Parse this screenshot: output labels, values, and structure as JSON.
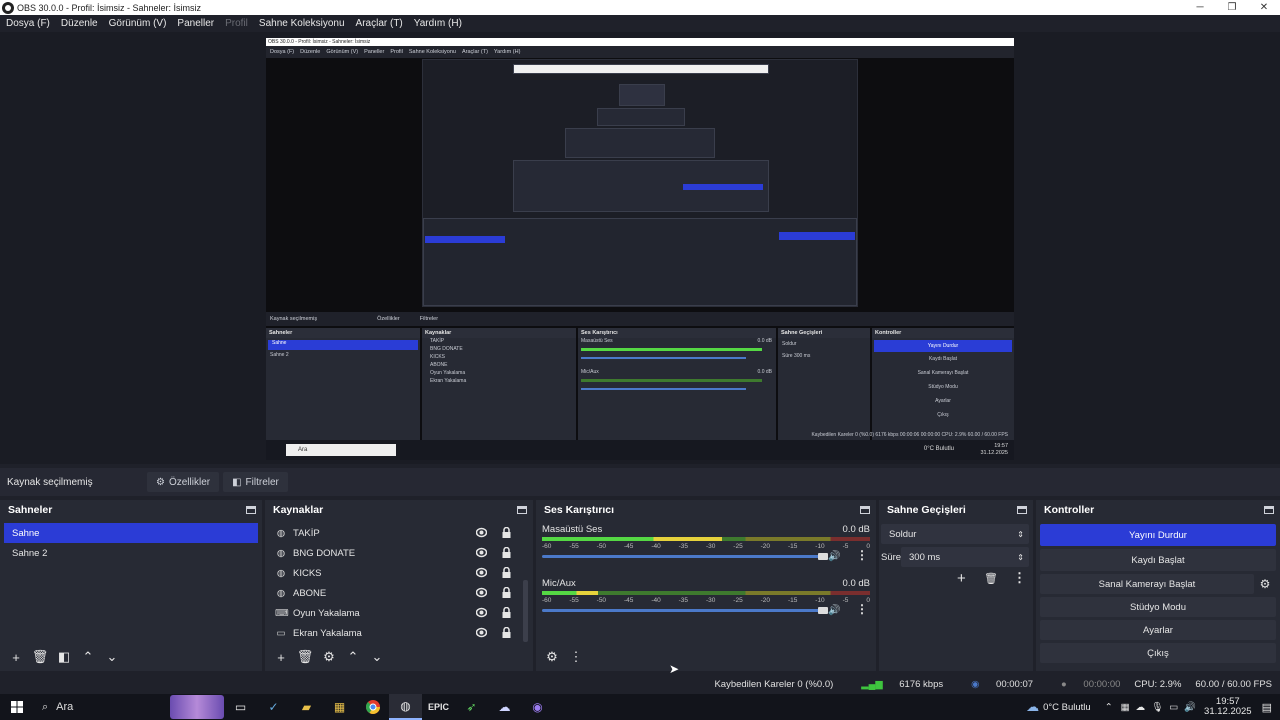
{
  "window": {
    "title": "OBS 30.0.0 - Profil: İsimsiz - Sahneler: İsimsiz",
    "minimize": "─",
    "maximize": "❐",
    "close": "✕"
  },
  "menu": {
    "items": [
      "Dosya (F)",
      "Düzenle",
      "Görünüm (V)",
      "Paneller",
      "Profil",
      "Sahne Koleksiyonu",
      "Araçlar (T)",
      "Yardım (H)"
    ]
  },
  "preview": {
    "menu_title": "OBS 30.0.0 - Profil: İsimsiz - Sahneler: İsimsiz",
    "menu_items": [
      "Dosya (F)",
      "Düzenle",
      "Görünüm (V)",
      "Paneller",
      "Profil",
      "Sahne Koleksiyonu",
      "Araçlar (T)",
      "Yardım (H)"
    ],
    "select_label": "Kaynak seçilmemiş",
    "props": "Özellikler",
    "filters": "Filtreler",
    "scenes_title": "Sahneler",
    "scenes": [
      "Sahne",
      "Sahne 2"
    ],
    "sources_title": "Kaynaklar",
    "sources": [
      "TAKİP",
      "BNG DONATE",
      "KICKS",
      "ABONE",
      "Oyun Yakalama",
      "Ekran Yakalama"
    ],
    "mixer_title": "Ses Karıştırıcı",
    "ch1": "Masaüstü Ses",
    "ch2": "Mic/Aux",
    "db": "0.0 dB",
    "trans_title": "Sahne Geçişleri",
    "trans": "Soldur",
    "dur_label": "Süre",
    "dur": "300 ms",
    "ctrl_title": "Kontroller",
    "ctrl": [
      "Yayını Durdur",
      "Kaydı Başlat",
      "Sanal Kamerayı Başlat",
      "Stüdyo Modu",
      "Ayarlar",
      "Çıkış"
    ],
    "status": "Kaybedilen Kareler 0 (%0.0)  6176 kbps  00:00:06  00:00:00  CPU: 2.9%  60.00 / 60.00 FPS",
    "search": "Ara",
    "weather": "0°C Bulutlu",
    "clock_time": "19:57",
    "clock_date": "31.12.2025"
  },
  "selection": {
    "label": "Kaynak seçilmemiş",
    "properties": "Özellikler",
    "filters": "Filtreler"
  },
  "scenes": {
    "title": "Sahneler",
    "items": [
      "Sahne",
      "Sahne 2"
    ]
  },
  "sources": {
    "title": "Kaynaklar",
    "items": [
      {
        "name": "TAKİP",
        "icon": "browser-icon"
      },
      {
        "name": "BNG DONATE",
        "icon": "browser-icon"
      },
      {
        "name": "KICKS",
        "icon": "browser-icon"
      },
      {
        "name": "ABONE",
        "icon": "browser-icon"
      },
      {
        "name": "Oyun Yakalama",
        "icon": "gamepad-icon"
      },
      {
        "name": "Ekran Yakalama",
        "icon": "monitor-icon"
      }
    ]
  },
  "mixer": {
    "title": "Ses Karıştırıcı",
    "channels": [
      {
        "name": "Masaüstü Ses",
        "db": "0.0 dB",
        "level": 0.55,
        "volume": 1.0
      },
      {
        "name": "Mic/Aux",
        "db": "0.0 dB",
        "level": 0.17,
        "volume": 1.0
      }
    ],
    "ticks": [
      "-60",
      "-55",
      "-50",
      "-45",
      "-40",
      "-35",
      "-30",
      "-25",
      "-20",
      "-15",
      "-10",
      "-5",
      "0"
    ]
  },
  "transitions": {
    "title": "Sahne Geçişleri",
    "type": "Soldur",
    "duration_label": "Süre",
    "duration": "300 ms"
  },
  "controls": {
    "title": "Kontroller",
    "stream": "Yayını Durdur",
    "record": "Kaydı Başlat",
    "virtualcam": "Sanal Kamerayı Başlat",
    "studio": "Stüdyo Modu",
    "settings": "Ayarlar",
    "exit": "Çıkış"
  },
  "status": {
    "dropped": "Kaybedilen Kareler 0 (%0.0)",
    "bitrate": "6176 kbps",
    "stream_time": "00:00:07",
    "rec_time": "00:00:00",
    "cpu": "CPU: 2.9%",
    "fps": "60.00 / 60.00 FPS"
  },
  "taskbar": {
    "search": "Ara",
    "weather": "0°C  Bulutlu",
    "time": "19:57",
    "date": "31.12.2025"
  },
  "colors": {
    "accent": "#2b3cd6",
    "bitrate_icon": "#3ec43e"
  }
}
